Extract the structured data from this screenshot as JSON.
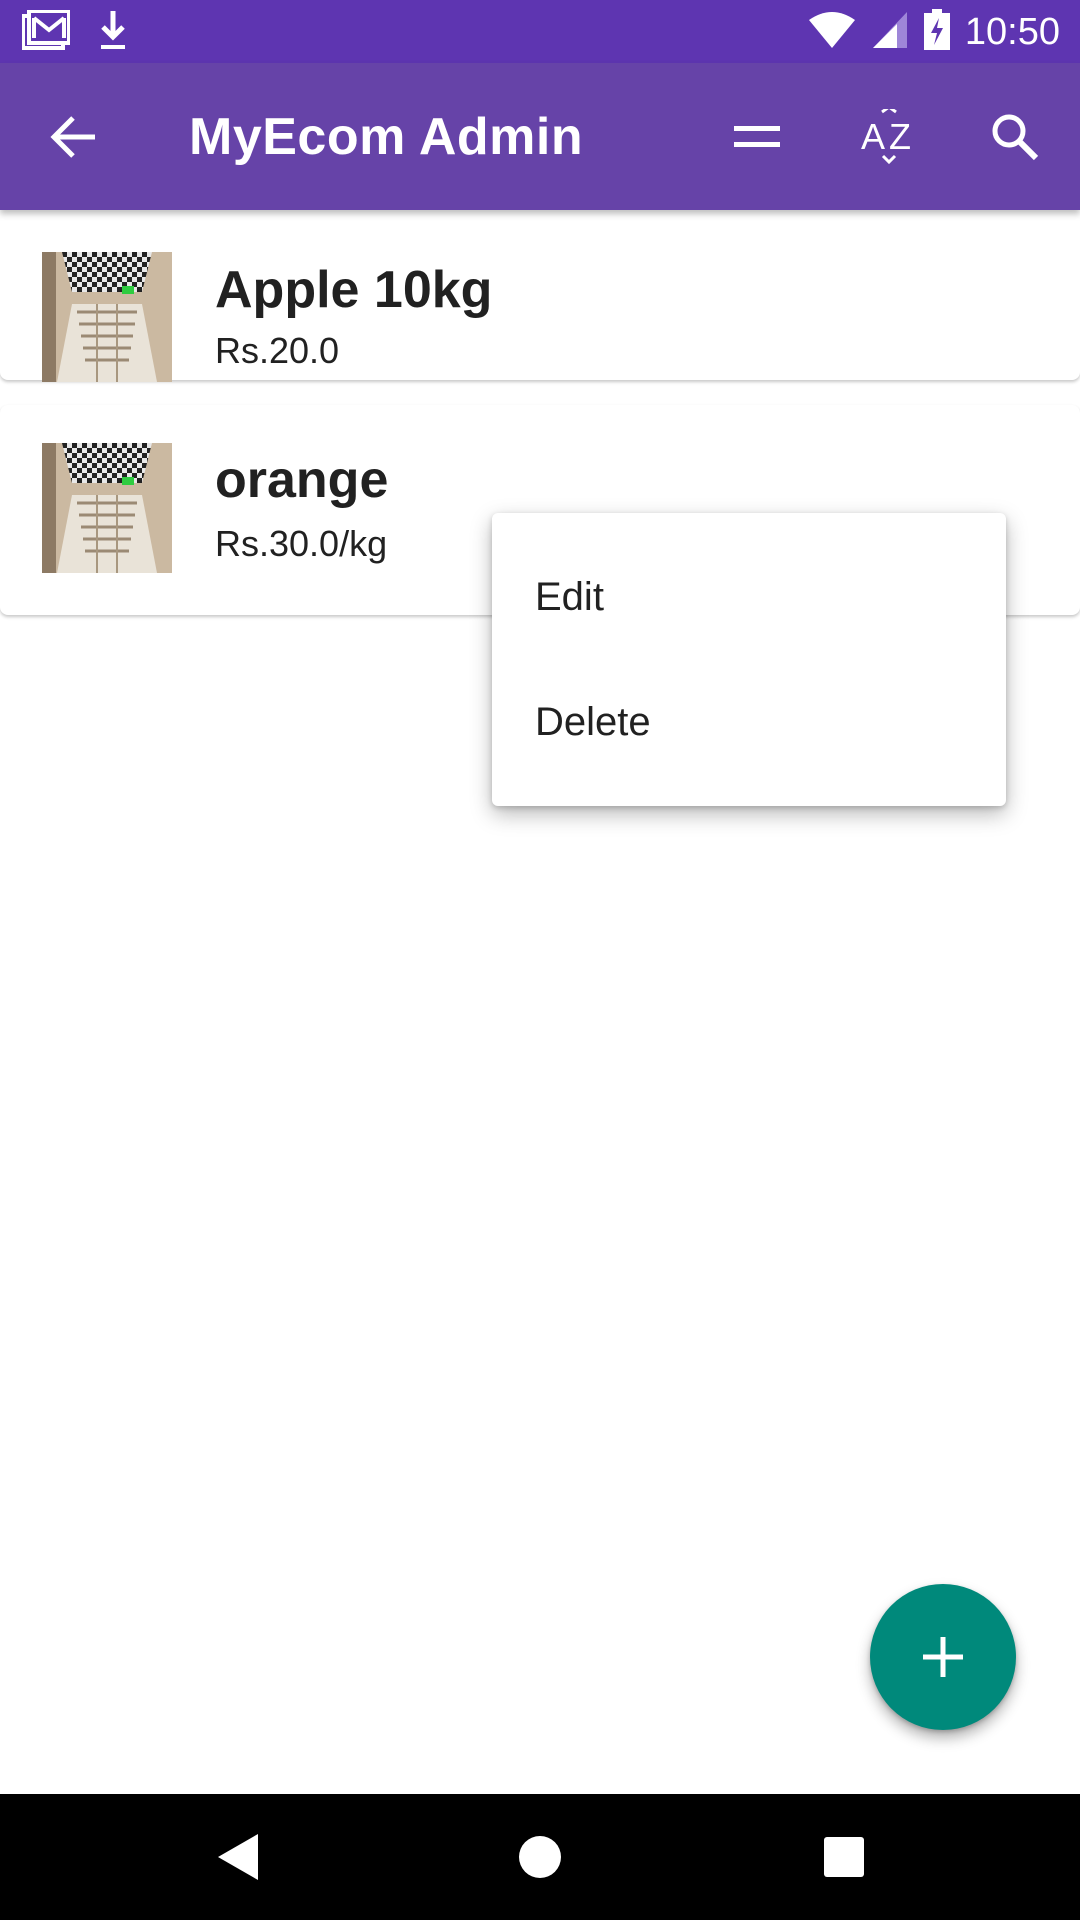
{
  "status_bar": {
    "time": "10:50",
    "icons": [
      "gmail-icon",
      "download-icon",
      "wifi-icon",
      "signal-icon",
      "battery-charging-icon"
    ]
  },
  "app_bar": {
    "title": "MyEcom Admin",
    "actions": [
      "back-arrow-icon",
      "sort-icon",
      "az-sort-icon",
      "search-icon"
    ]
  },
  "products": [
    {
      "name": "Apple 10kg",
      "price": "Rs.20.0"
    },
    {
      "name": "orange",
      "price": "Rs.30.0/kg"
    }
  ],
  "popup_menu": {
    "items": [
      {
        "label": "Edit"
      },
      {
        "label": "Delete"
      }
    ]
  },
  "fab": {
    "icon": "plus-icon"
  },
  "nav_bar": {
    "icons": [
      "back-triangle-icon",
      "home-circle-icon",
      "recents-square-icon"
    ]
  },
  "colors": {
    "status_bar": "#5e35b1",
    "app_bar": "#6643a8",
    "fab": "#00897b"
  }
}
